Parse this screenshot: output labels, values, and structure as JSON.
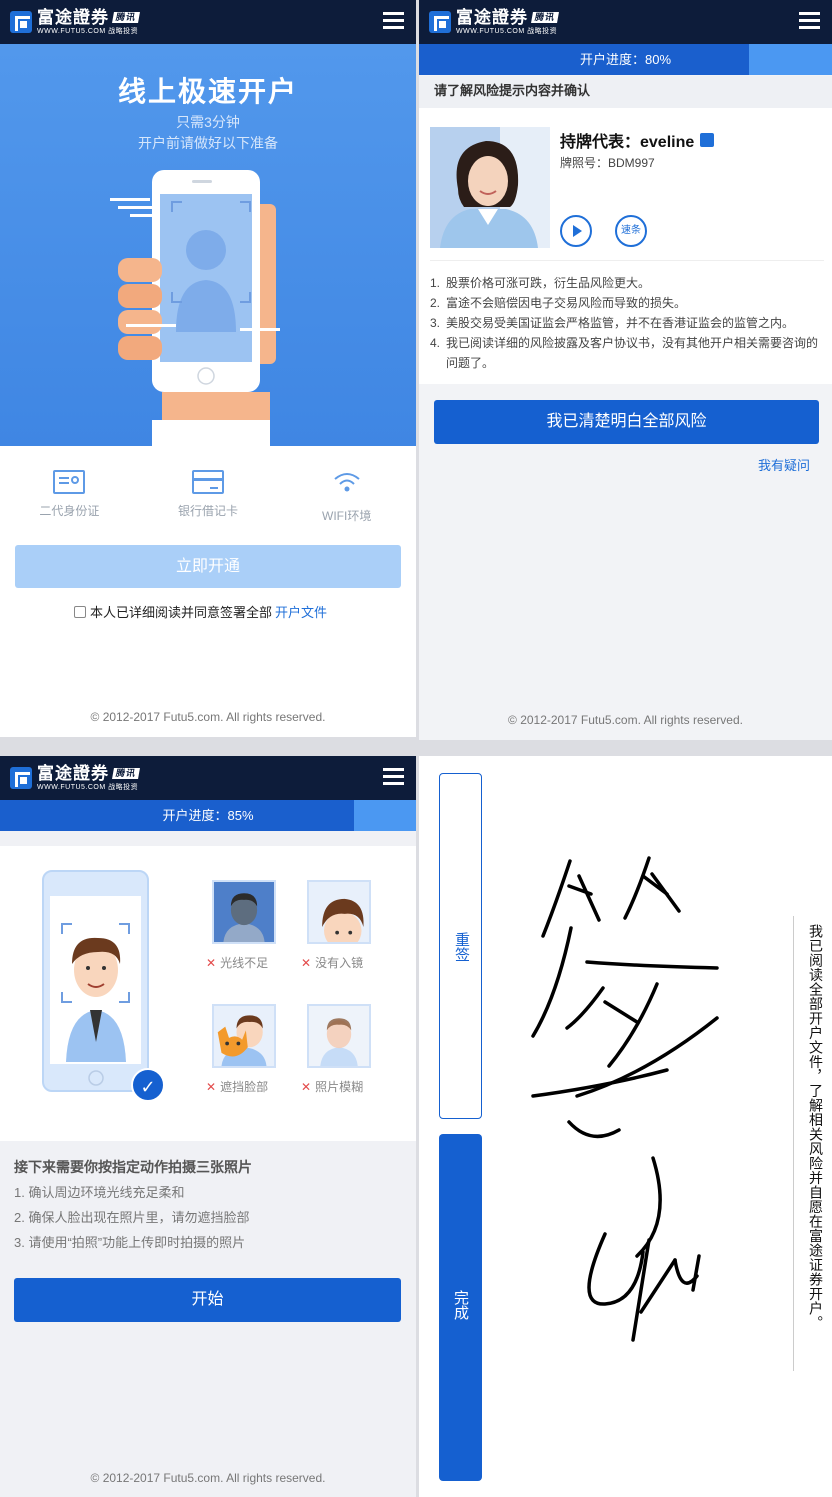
{
  "brand": {
    "name_cn": "富途證券",
    "badge": "腾讯",
    "url": "WWW.FUTU5.COM",
    "badge_sub": "战略投资",
    "colors": {
      "navbar": "#0d1c3a",
      "primary": "#1560d0",
      "hero": "#4a90e6",
      "error": "#e34b4b"
    }
  },
  "panel1": {
    "title": "线上极速开户",
    "subtitle1": "只需3分钟",
    "subtitle2": "开户前请做好以下准备",
    "features": [
      {
        "icon": "id-card-icon",
        "label": "二代身份证"
      },
      {
        "icon": "bank-card-icon",
        "label": "银行借记卡"
      },
      {
        "icon": "wifi-icon",
        "label": "WIFI环境"
      }
    ],
    "open_button": "立即开通",
    "agree_text": "本人已详细阅读并同意签署全部",
    "agree_link": "开户文件",
    "footer": "© 2012-2017 Futu5.com. All rights reserved."
  },
  "panel2": {
    "progress_label": "开户进度：80%",
    "progress_value": 0.8,
    "header": "请了解风险提示内容并确认",
    "rep_label": "持牌代表：eveline",
    "license": "牌照号：BDM997",
    "play_icon": "play-icon",
    "note_button": "速条",
    "risks": [
      {
        "num": "1.",
        "text": "股票价格可涨可跌，衍生品风险更大。"
      },
      {
        "num": "2.",
        "text": "富途不会赔偿因电子交易风险而导致的损失。"
      },
      {
        "num": "3.",
        "text": "美股交易受美国证监会严格监管，并不在香港证监会的监管之内。"
      },
      {
        "num": "4.",
        "text": "我已阅读详细的风险披露及客户协议书，没有其他开户相关需要咨询的问题了。"
      }
    ],
    "confirm_button": "我已清楚明白全部风险",
    "question_link": "我有疑问",
    "footer": "© 2012-2017 Futu5.com. All rights reserved."
  },
  "panel3": {
    "progress_label": "开户进度：85%",
    "progress_value": 0.85,
    "samples": [
      {
        "label": "光线不足"
      },
      {
        "label": "没有入镜"
      },
      {
        "label": "遮挡脸部"
      },
      {
        "label": "照片模糊"
      }
    ],
    "instr_title": "接下来需要你按指定动作拍摄三张照片",
    "instructions": [
      "1. 确认周边环境光线充足柔和",
      "2. 确保人脸出现在照片里，请勿遮挡脸部",
      "3. 请使用“拍照”功能上传即时拍摄的照片"
    ],
    "start_button": "开始",
    "footer": "© 2012-2017 Futu5.com. All rights reserved."
  },
  "panel4": {
    "resign_button": "重签",
    "done_button": "完成",
    "statement": "我已阅读全部开户文件，了解相关风险并自愿在富途证券开户。"
  }
}
